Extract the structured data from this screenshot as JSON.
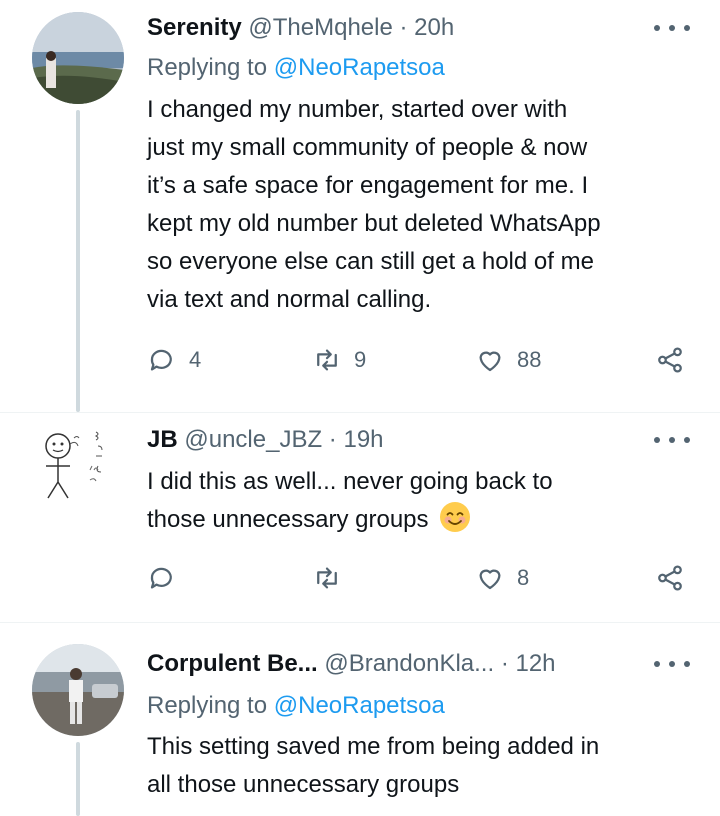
{
  "tweets": [
    {
      "name": "Serenity",
      "handle": "@TheMqhele",
      "separator": "·",
      "time": "20h",
      "replying_prefix": "Replying to",
      "replying_handle": "@NeoRapetsoa",
      "text_lines": [
        "I changed my number, started over with",
        "just my small community of people & now",
        "it’s a safe space for engagement for me. I",
        "kept my old number but deleted WhatsApp",
        "so everyone else can still get a hold of me",
        "via text and normal calling."
      ],
      "replies": "4",
      "retweets": "9",
      "likes": "88"
    },
    {
      "name": "JB",
      "handle": "@uncle_JBZ",
      "separator": "·",
      "time": "19h",
      "text_lines": [
        "I did this as well... never going back to",
        "those unnecessary groups"
      ],
      "emoji": "smiling-face-with-smiling-eyes",
      "replies": "",
      "retweets": "",
      "likes": "8"
    },
    {
      "name": "Corpulent Be...",
      "handle": "@BrandonKla...",
      "separator": "·",
      "time": "12h",
      "replying_prefix": "Replying to",
      "replying_handle": "@NeoRapetsoa",
      "text_lines": [
        "This setting saved me from being added in",
        "all those unnecessary groups"
      ]
    }
  ],
  "icons": {
    "reply": "reply-icon",
    "retweet": "retweet-icon",
    "like": "heart-icon",
    "share": "share-icon",
    "more": "more-icon"
  },
  "colors": {
    "text": "#0f1419",
    "secondary": "#536471",
    "link": "#1d9bf0",
    "thread_line": "#cfd9de",
    "divider": "#eff3f4"
  }
}
